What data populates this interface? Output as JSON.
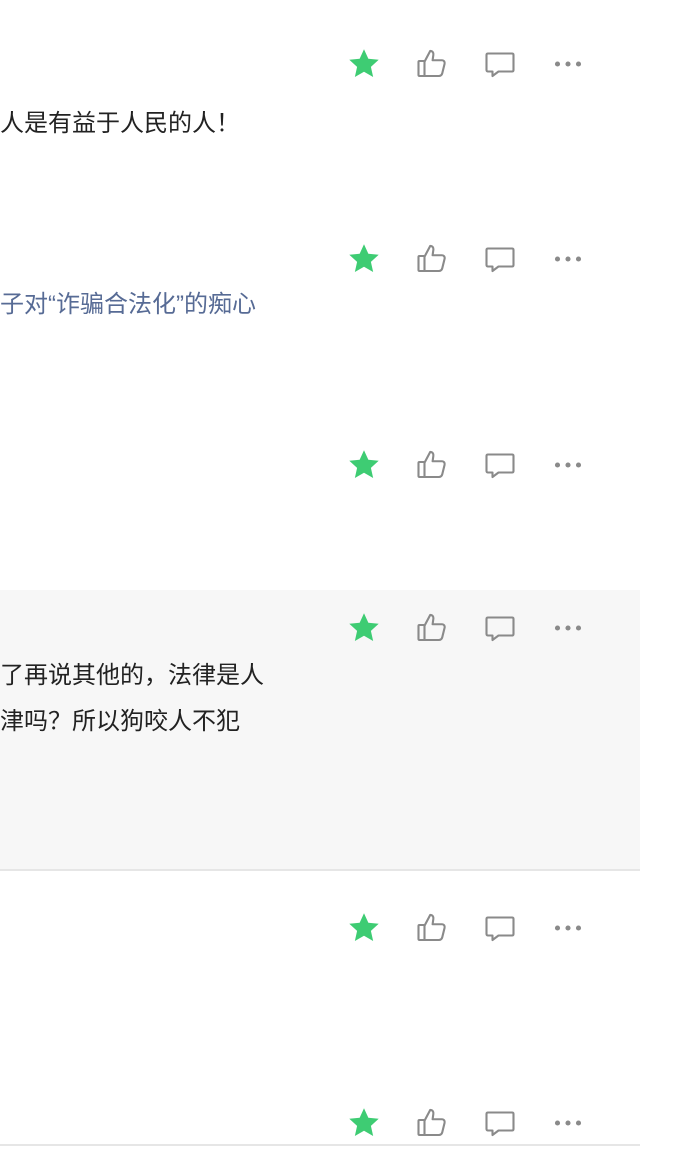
{
  "colors": {
    "star": "#3ecc73",
    "icon": "#8a8a8a",
    "text": "#222222",
    "link": "#576b95",
    "shaded_bg": "#f7f7f7",
    "divider": "#e6e6e6"
  },
  "icons": {
    "favorite": "star-icon",
    "like": "thumbs-up-icon",
    "reply": "comment-bubble-icon",
    "more": "more-dots-icon"
  },
  "comments": [
    {
      "text": "人是有益于人民的人！"
    },
    {
      "text": "子对“诈骗合法化”的痴心"
    },
    {
      "text": ""
    },
    {
      "lines": [
        "了再说其他的，法律是人",
        "津吗？所以狗咬人不犯"
      ]
    },
    {
      "text": ""
    },
    {
      "text": ""
    }
  ]
}
